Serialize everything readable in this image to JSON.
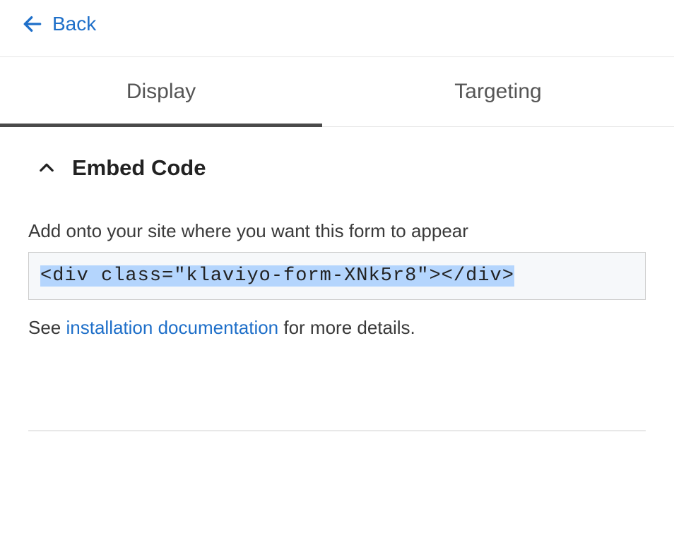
{
  "nav": {
    "back_label": "Back"
  },
  "tabs": {
    "display": "Display",
    "targeting": "Targeting"
  },
  "embed": {
    "section_title": "Embed Code",
    "instruction": "Add onto your site where you want this form to appear",
    "code_snippet": "<div class=\"klaviyo-form-XNk5r8\"></div>",
    "details_prefix": "See ",
    "doc_link_text": "installation documentation",
    "details_suffix": " for more details."
  }
}
